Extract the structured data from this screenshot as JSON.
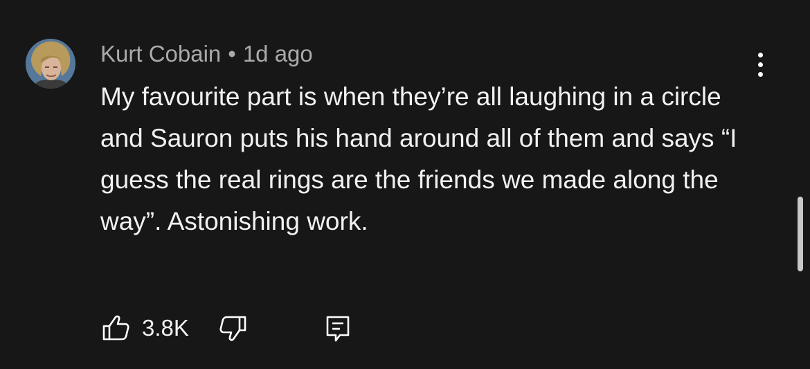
{
  "comment": {
    "author": "Kurt Cobain",
    "separator": "•",
    "timestamp": "1d ago",
    "text": "My favourite part is when they’re all laughing in a circle and Sauron puts his hand around all of them and says “I guess the real rings are the friends we made along the way”. Astonishing work.",
    "like_count": "3.8K"
  },
  "icons": {
    "more": "more-vertical-icon",
    "like": "thumbs-up-icon",
    "dislike": "thumbs-down-icon",
    "reply": "reply-icon"
  },
  "colors": {
    "background": "#171717",
    "meta_text": "#aaaaaa",
    "body_text": "#f1f1f1",
    "icon": "#ffffff"
  }
}
